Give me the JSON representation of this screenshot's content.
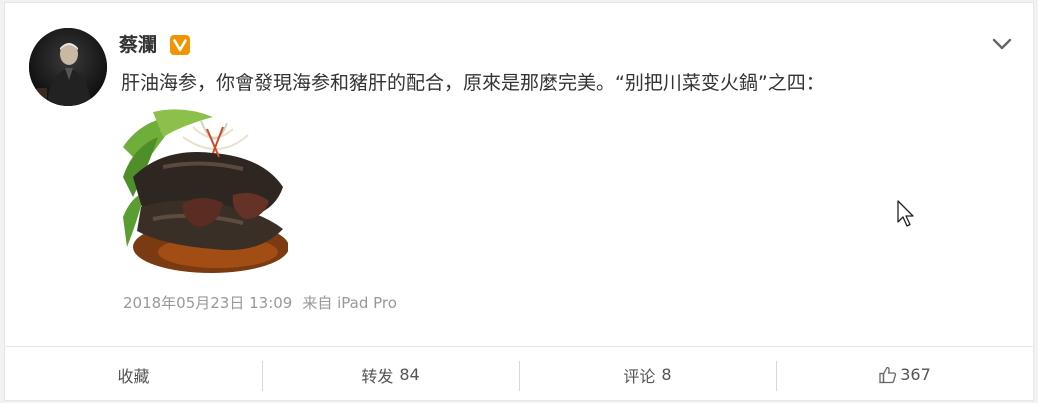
{
  "post": {
    "username": "蔡瀾",
    "verified_badge": "verified-v-icon",
    "text": "肝油海参，你會發現海参和豬肝的配合，原來是那麼完美。“别把川菜变火鍋”之四：",
    "timestamp": "2018年05月23日 13:09",
    "source": "来自 iPad Pro"
  },
  "actions": {
    "favorite_label": "收藏",
    "repost_label": "转发",
    "repost_count": "84",
    "comment_label": "评论",
    "comment_count": "8",
    "like_count": "367"
  },
  "colors": {
    "badge": "#f29400",
    "text": "#333333",
    "meta": "#999999",
    "divider": "#e6e6e6"
  }
}
